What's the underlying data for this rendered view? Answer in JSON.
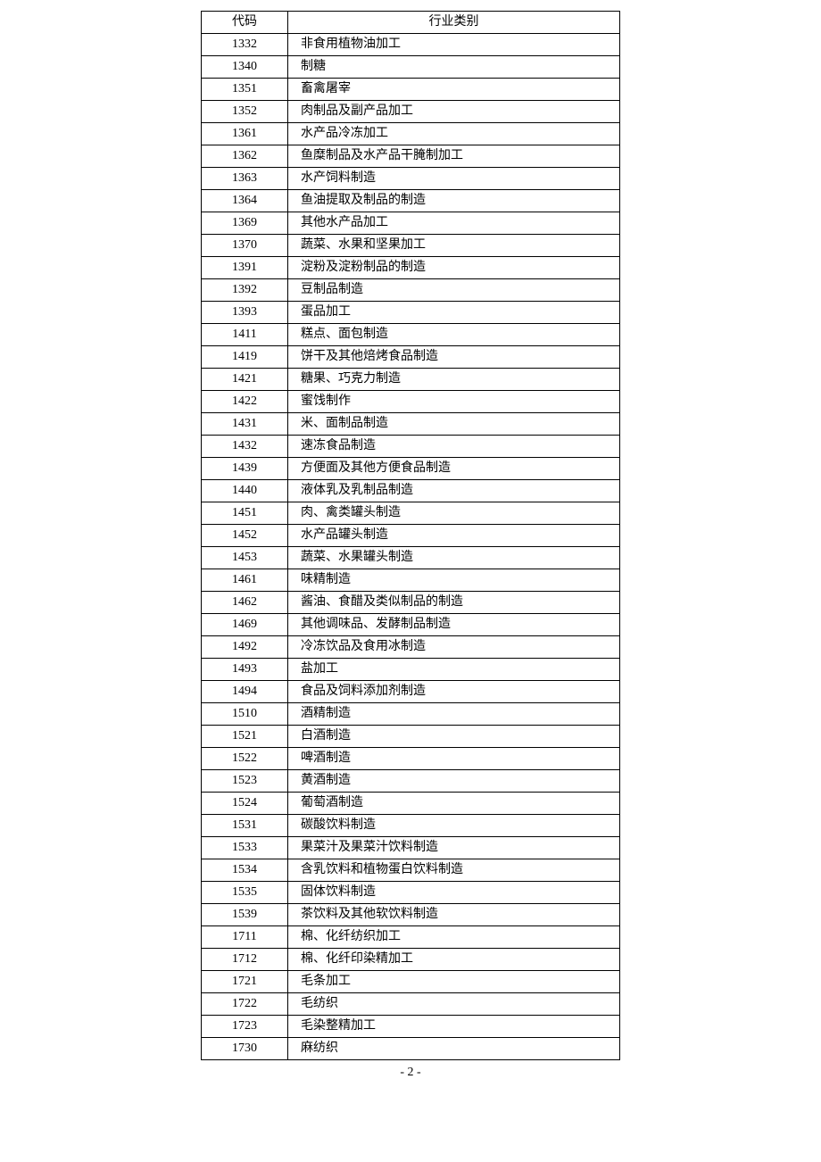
{
  "headers": {
    "code": "代码",
    "category": "行业类别"
  },
  "rows": [
    {
      "code": "1332",
      "category": "非食用植物油加工"
    },
    {
      "code": "1340",
      "category": "制糖"
    },
    {
      "code": "1351",
      "category": "畜禽屠宰"
    },
    {
      "code": "1352",
      "category": "肉制品及副产品加工"
    },
    {
      "code": "1361",
      "category": "水产品冷冻加工"
    },
    {
      "code": "1362",
      "category": "鱼糜制品及水产品干腌制加工"
    },
    {
      "code": "1363",
      "category": "水产饲料制造"
    },
    {
      "code": "1364",
      "category": "鱼油提取及制品的制造"
    },
    {
      "code": "1369",
      "category": "其他水产品加工"
    },
    {
      "code": "1370",
      "category": "蔬菜、水果和坚果加工"
    },
    {
      "code": "1391",
      "category": "淀粉及淀粉制品的制造"
    },
    {
      "code": "1392",
      "category": "豆制品制造"
    },
    {
      "code": "1393",
      "category": "蛋品加工"
    },
    {
      "code": "1411",
      "category": "糕点、面包制造"
    },
    {
      "code": "1419",
      "category": "饼干及其他焙烤食品制造"
    },
    {
      "code": "1421",
      "category": "糖果、巧克力制造"
    },
    {
      "code": "1422",
      "category": "蜜饯制作"
    },
    {
      "code": "1431",
      "category": "米、面制品制造"
    },
    {
      "code": "1432",
      "category": "速冻食品制造"
    },
    {
      "code": "1439",
      "category": "方便面及其他方便食品制造"
    },
    {
      "code": "1440",
      "category": "液体乳及乳制品制造"
    },
    {
      "code": "1451",
      "category": "肉、禽类罐头制造"
    },
    {
      "code": "1452",
      "category": "水产品罐头制造"
    },
    {
      "code": "1453",
      "category": "蔬菜、水果罐头制造"
    },
    {
      "code": "1461",
      "category": "味精制造"
    },
    {
      "code": "1462",
      "category": "酱油、食醋及类似制品的制造"
    },
    {
      "code": "1469",
      "category": "其他调味品、发酵制品制造"
    },
    {
      "code": "1492",
      "category": "冷冻饮品及食用冰制造"
    },
    {
      "code": "1493",
      "category": "盐加工"
    },
    {
      "code": "1494",
      "category": "食品及饲料添加剂制造"
    },
    {
      "code": "1510",
      "category": "酒精制造"
    },
    {
      "code": "1521",
      "category": "白酒制造"
    },
    {
      "code": "1522",
      "category": "啤酒制造"
    },
    {
      "code": "1523",
      "category": "黄酒制造"
    },
    {
      "code": "1524",
      "category": "葡萄酒制造"
    },
    {
      "code": "1531",
      "category": "碳酸饮料制造"
    },
    {
      "code": "1533",
      "category": "果菜汁及果菜汁饮料制造"
    },
    {
      "code": "1534",
      "category": "含乳饮料和植物蛋白饮料制造"
    },
    {
      "code": "1535",
      "category": "固体饮料制造"
    },
    {
      "code": "1539",
      "category": "茶饮料及其他软饮料制造"
    },
    {
      "code": "1711",
      "category": "棉、化纤纺织加工"
    },
    {
      "code": "1712",
      "category": "棉、化纤印染精加工"
    },
    {
      "code": "1721",
      "category": "毛条加工"
    },
    {
      "code": "1722",
      "category": "毛纺织"
    },
    {
      "code": "1723",
      "category": "毛染整精加工"
    },
    {
      "code": "1730",
      "category": "麻纺织"
    }
  ],
  "page_number": "- 2 -"
}
